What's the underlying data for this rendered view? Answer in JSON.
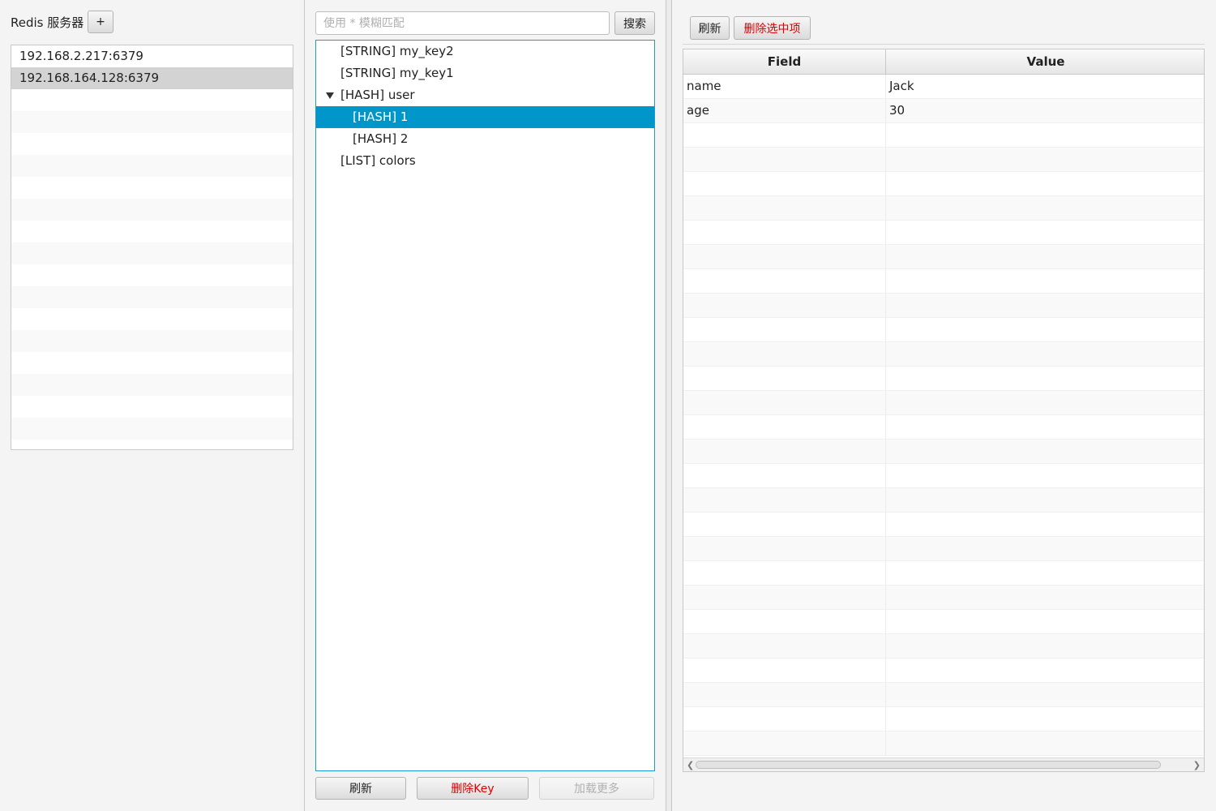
{
  "servers": {
    "title": "Redis 服务器",
    "add_label": "+",
    "items": [
      "192.168.2.217:6379",
      "192.168.164.128:6379"
    ],
    "selected_index": 1
  },
  "keys": {
    "search_placeholder": "使用 * 模糊匹配",
    "search_label": "搜索",
    "tree": [
      {
        "label": "[STRING] my_key2",
        "depth": 0,
        "expanded": null,
        "selected": false
      },
      {
        "label": "[STRING] my_key1",
        "depth": 0,
        "expanded": null,
        "selected": false
      },
      {
        "label": "[HASH] user",
        "depth": 0,
        "expanded": true,
        "selected": false
      },
      {
        "label": "[HASH] 1",
        "depth": 1,
        "expanded": null,
        "selected": true
      },
      {
        "label": "[HASH] 2",
        "depth": 1,
        "expanded": null,
        "selected": false
      },
      {
        "label": "[LIST] colors",
        "depth": 0,
        "expanded": null,
        "selected": false
      }
    ],
    "refresh_label": "刷新",
    "delete_label": "删除Key",
    "load_more_label": "加载更多"
  },
  "detail": {
    "refresh_label": "刷新",
    "delete_selected_label": "删除选中项",
    "columns": [
      "Field",
      "Value"
    ],
    "rows": [
      {
        "field": "name",
        "value": "Jack"
      },
      {
        "field": "age",
        "value": "30"
      }
    ]
  },
  "colors": {
    "selection": "#0096c9",
    "danger_text": "#e00000",
    "tree_border": "#1c9ad6"
  }
}
